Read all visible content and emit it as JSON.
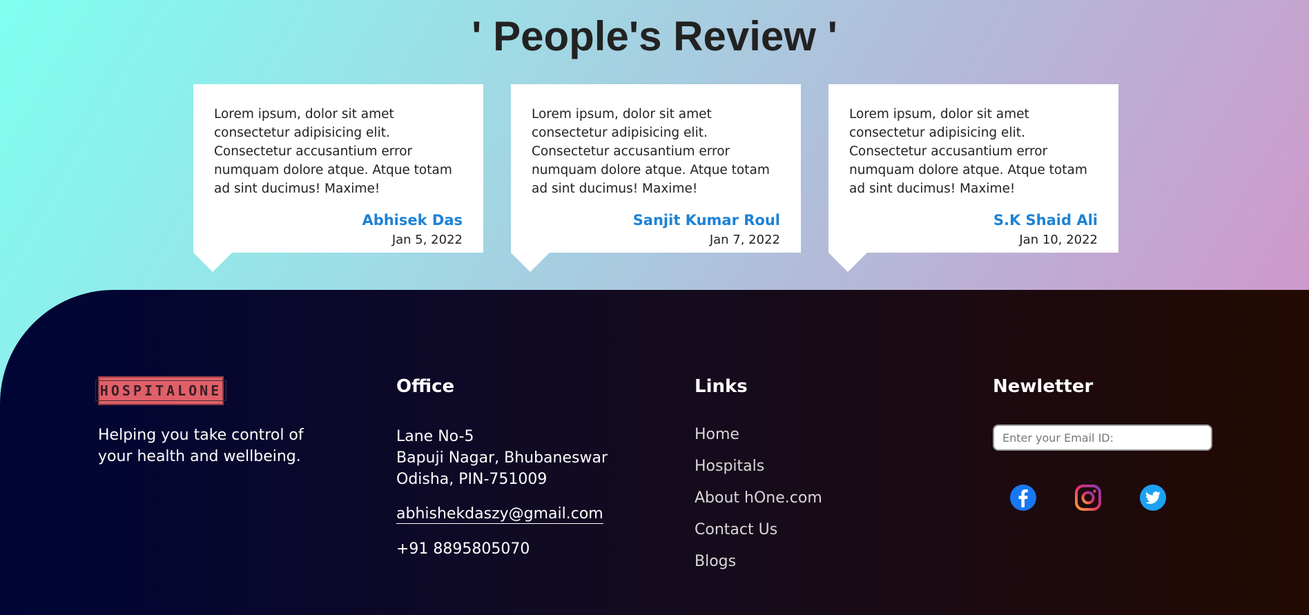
{
  "reviews": {
    "title": "' People's Review '",
    "items": [
      {
        "text": "Lorem ipsum, dolor sit amet consectetur adipisicing elit. Consectetur accusantium error numquam dolore atque. Atque totam ad sint ducimus! Maxime!",
        "author": "Abhisek Das",
        "date": "Jan 5, 2022"
      },
      {
        "text": "Lorem ipsum, dolor sit amet consectetur adipisicing elit. Consectetur accusantium error numquam dolore atque. Atque totam ad sint ducimus! Maxime!",
        "author": "Sanjit Kumar Roul",
        "date": "Jan 7, 2022"
      },
      {
        "text": "Lorem ipsum, dolor sit amet consectetur adipisicing elit. Consectetur accusantium error numquam dolore atque. Atque totam ad sint ducimus! Maxime!",
        "author": "S.K Shaid Ali",
        "date": "Jan 10, 2022"
      }
    ]
  },
  "footer": {
    "logo_text": "HOSPITALONE",
    "tagline": "Helping you take control of your health and wellbeing.",
    "office": {
      "title": "Office",
      "address_line1": "Lane No-5",
      "address_line2": "Bapuji Nagar, Bhubaneswar",
      "address_line3": "Odisha, PIN-751009",
      "email": "abhishekdaszy@gmail.com",
      "phone": "+91 8895805070"
    },
    "links": {
      "title": "Links",
      "items": [
        "Home",
        "Hospitals",
        "About hOne.com",
        "Contact Us",
        "Blogs"
      ]
    },
    "newsletter": {
      "title": "Newletter",
      "placeholder": "Enter your Email ID:",
      "socials": [
        "facebook-icon",
        "instagram-icon",
        "twitter-icon"
      ]
    }
  },
  "colors": {
    "accent": "#1e82d4",
    "logo_bg": "#e0606a",
    "footer_start": "#000536",
    "footer_end": "#230a02"
  }
}
